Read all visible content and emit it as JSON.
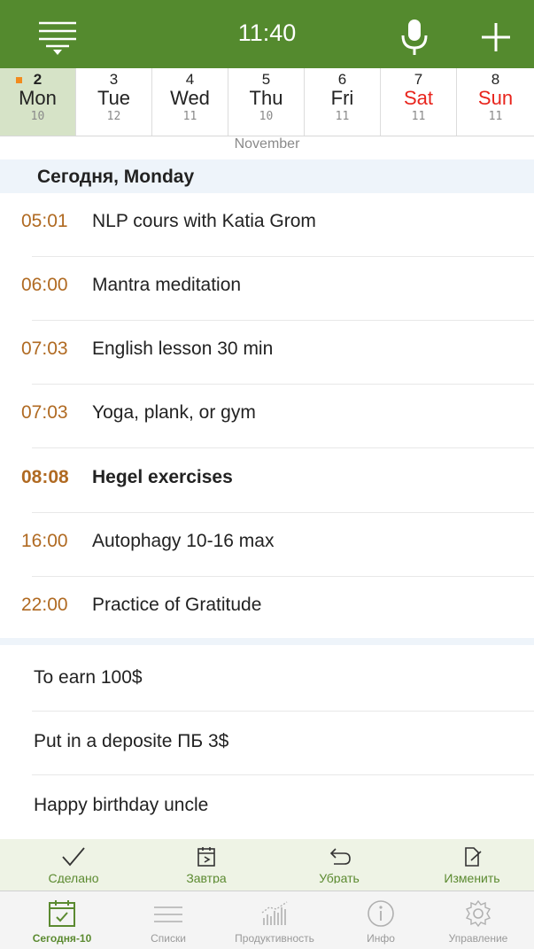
{
  "header": {
    "time": "11:40",
    "menu_icon": "menu-filter-icon",
    "mic_icon": "microphone-icon",
    "add_icon": "plus-icon",
    "bg_color": "#548a2e"
  },
  "week": {
    "days": [
      {
        "num": "2",
        "name": "Mon",
        "count": "10",
        "selected": true,
        "weekend": false
      },
      {
        "num": "3",
        "name": "Tue",
        "count": "12",
        "selected": false,
        "weekend": false
      },
      {
        "num": "4",
        "name": "Wed",
        "count": "11",
        "selected": false,
        "weekend": false
      },
      {
        "num": "5",
        "name": "Thu",
        "count": "10",
        "selected": false,
        "weekend": false
      },
      {
        "num": "6",
        "name": "Fri",
        "count": "11",
        "selected": false,
        "weekend": false
      },
      {
        "num": "7",
        "name": "Sat",
        "count": "11",
        "selected": false,
        "weekend": true
      },
      {
        "num": "8",
        "name": "Sun",
        "count": "11",
        "selected": false,
        "weekend": true
      }
    ],
    "month": "November"
  },
  "section": {
    "title": "Сегодня, Monday"
  },
  "events": [
    {
      "time": "05:01",
      "title": "NLP cours with Katia Grom"
    },
    {
      "time": "06:00",
      "title": "Mantra meditation"
    },
    {
      "time": "07:03",
      "title": "English lesson 30 min"
    },
    {
      "time": "07:03",
      "title": "Yoga, plank, or gym"
    },
    {
      "time": "08:08",
      "title": "Hegel exercises"
    },
    {
      "time": "16:00",
      "title": "Autophagy 10-16 max"
    },
    {
      "time": "22:00",
      "title": "Practice of Gratitude"
    }
  ],
  "tasks": [
    {
      "title": "To earn 100$"
    },
    {
      "title": "Put in a deposite ПБ 3$"
    },
    {
      "title": "Happy birthday uncle"
    }
  ],
  "actions": [
    {
      "label": "Сделано",
      "icon": "checkmark-icon"
    },
    {
      "label": "Завтра",
      "icon": "calendar-arrow-icon"
    },
    {
      "label": "Убрать",
      "icon": "undo-arrow-icon"
    },
    {
      "label": "Изменить",
      "icon": "edit-document-icon"
    }
  ],
  "tabs": [
    {
      "label": "Сегодня-10",
      "icon": "calendar-check-icon",
      "active": true
    },
    {
      "label": "Списки",
      "icon": "list-lines-icon",
      "active": false
    },
    {
      "label": "Продуктивность",
      "icon": "bar-chart-icon",
      "active": false
    },
    {
      "label": "Инфо",
      "icon": "info-icon",
      "active": false
    },
    {
      "label": "Управление",
      "icon": "gear-icon",
      "active": false
    }
  ],
  "colors": {
    "accent_green": "#548a2e",
    "time_orange": "#b06a22",
    "weekend_red": "#e8241c",
    "selected_day_bg": "#d6e3c7",
    "section_bg": "#eef4fa"
  }
}
